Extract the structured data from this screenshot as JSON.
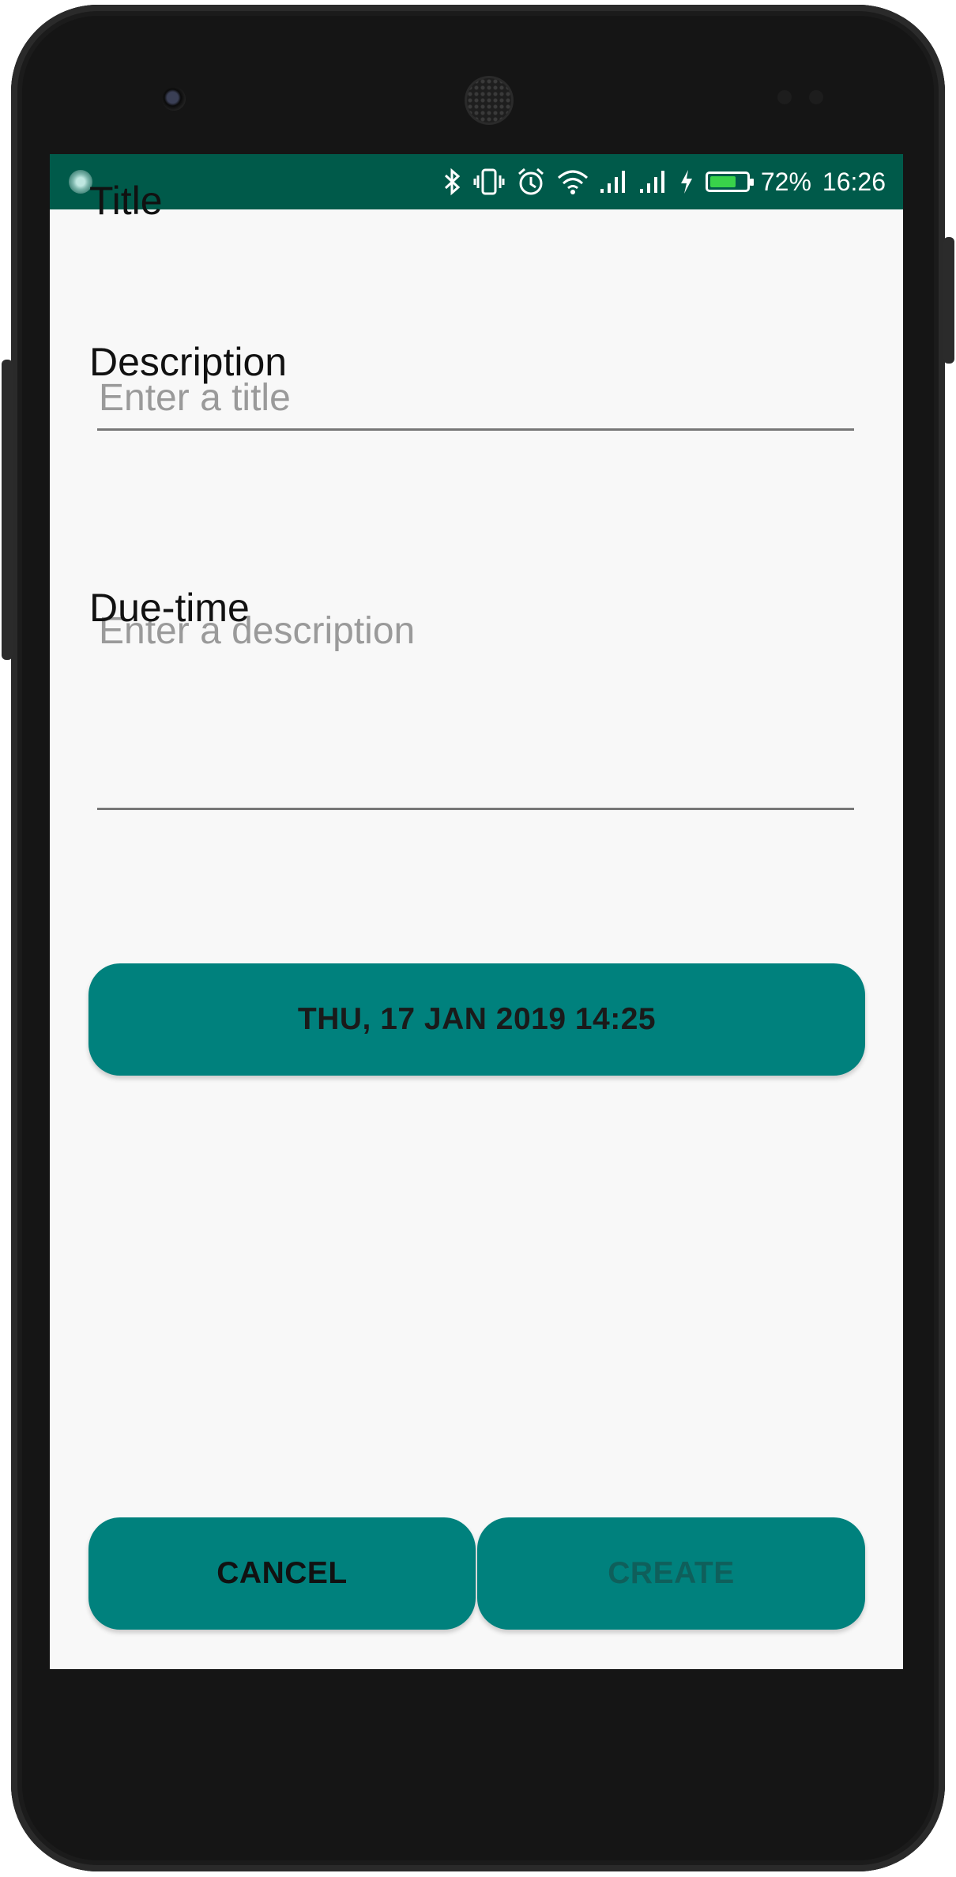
{
  "status_bar": {
    "battery_percent": "72%",
    "time": "16:26",
    "battery_level": 0.72,
    "background_color": "#005a4a",
    "icons": [
      "app-notification-icon",
      "bluetooth-icon",
      "vibrate-icon",
      "alarm-icon",
      "wifi-icon",
      "signal-icon",
      "signal-icon",
      "charging-icon",
      "battery-icon"
    ]
  },
  "form": {
    "title_label": "Title",
    "title_placeholder": "Enter a title",
    "title_value": "",
    "description_label": "Description",
    "description_placeholder": "Enter a description",
    "description_value": "",
    "due_time_label": "Due-time",
    "due_time_button": "THU, 17 JAN 2019 14:25"
  },
  "actions": {
    "cancel_label": "CANCEL",
    "create_label": "CREATE"
  },
  "colors": {
    "accent": "#00817d",
    "screen_background": "#f8f8f8",
    "create_disabled_text": "#0f5f5b"
  }
}
